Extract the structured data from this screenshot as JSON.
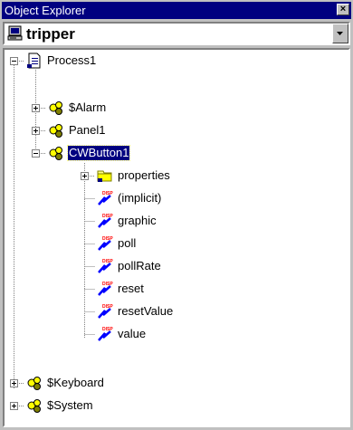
{
  "window": {
    "title": "Object Explorer",
    "close_glyph": "×"
  },
  "project": {
    "name": "tripper",
    "icon": "computer-icon"
  },
  "tree": {
    "process": "Process1",
    "alarm": "$Alarm",
    "panel": "Panel1",
    "cwbutton": "CWButton1",
    "properties": "properties",
    "props": [
      "(implicit)",
      "graphic",
      "poll",
      "pollRate",
      "reset",
      "resetValue",
      "value"
    ],
    "keyboard": "$Keyboard",
    "system": "$System"
  },
  "colors": {
    "selection": "#000080",
    "titlebar": "#000080",
    "face": "#c0c0c0"
  }
}
